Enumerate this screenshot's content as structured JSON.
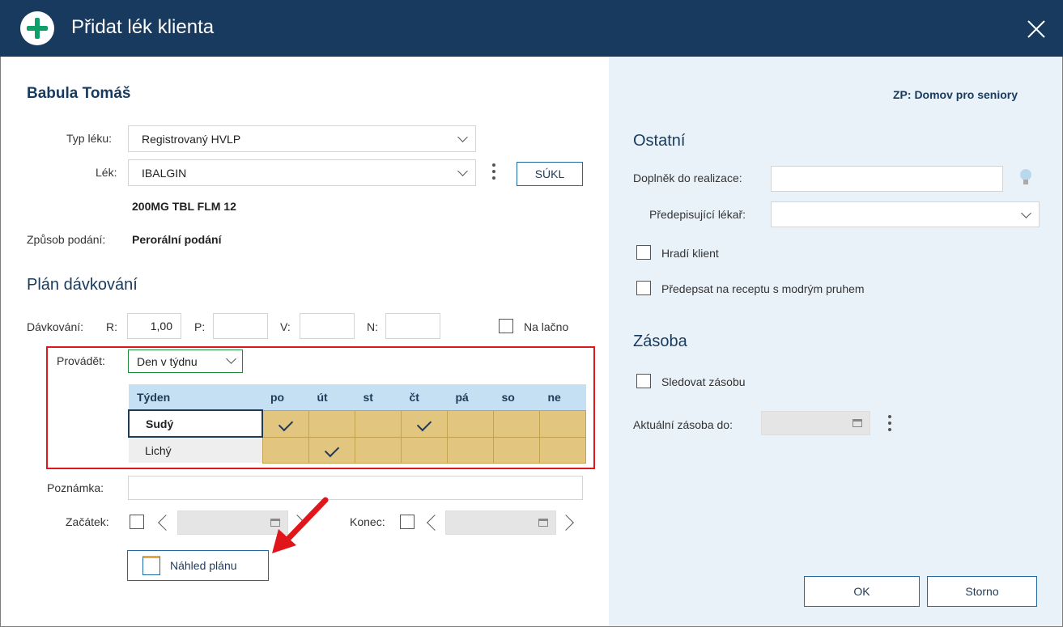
{
  "dialog": {
    "title": "Přidat lék klienta",
    "close_icon": "close-icon"
  },
  "patient": {
    "name": "Babula Tomáš"
  },
  "form": {
    "typ_leku_label": "Typ léku:",
    "typ_leku_value": "Registrovaný HVLP",
    "lek_label": "Lék:",
    "lek_value": "IBALGIN",
    "sukl_button": "SÚKL",
    "lek_detail": "200MG TBL FLM 12",
    "zpusob_label": "Způsob podání:",
    "zpusob_value": "Perorální podání"
  },
  "plan": {
    "heading": "Plán dávkování",
    "davkovani_label": "Dávkování:",
    "r_label": "R:",
    "r_value": "1,00",
    "p_label": "P:",
    "p_value": "",
    "v_label": "V:",
    "v_value": "",
    "n_label": "N:",
    "n_value": "",
    "na_lacno_label": "Na lačno",
    "provadet_label": "Provádět:",
    "provadet_value": "Den v týdnu",
    "table": {
      "week_header": "Týden",
      "days": [
        "po",
        "út",
        "st",
        "čt",
        "pá",
        "so",
        "ne"
      ],
      "rows": [
        {
          "label": "Sudý",
          "checked": [
            true,
            false,
            false,
            true,
            false,
            false,
            false
          ]
        },
        {
          "label": "Lichý",
          "checked": [
            false,
            true,
            false,
            false,
            false,
            false,
            false
          ]
        }
      ]
    },
    "poznamka_label": "Poznámka:",
    "poznamka_value": "",
    "zacatek_label": "Začátek:",
    "konec_label": "Konec:",
    "nahled_button": "Náhled plánu"
  },
  "right": {
    "zp": "ZP: Domov pro seniory",
    "ostatni_heading": "Ostatní",
    "doplnek_label": "Doplněk do realizace:",
    "doplnek_value": "",
    "lekar_label": "Předepisující lékař:",
    "lekar_value": "",
    "hradi_label": "Hradí klient",
    "predepsat_label": "Předepsat na receptu s modrým pruhem",
    "zasoba_heading": "Zásoba",
    "sledovat_label": "Sledovat zásobu",
    "aktualni_label": "Aktuální zásoba do:"
  },
  "buttons": {
    "ok": "OK",
    "storno": "Storno"
  },
  "colors": {
    "titlebar": "#173a5e",
    "accent_green": "#0fa06a",
    "highlight_red": "#e0161b",
    "right_pane": "#eaf2f9",
    "schedule_cell": "#e2c57e"
  }
}
